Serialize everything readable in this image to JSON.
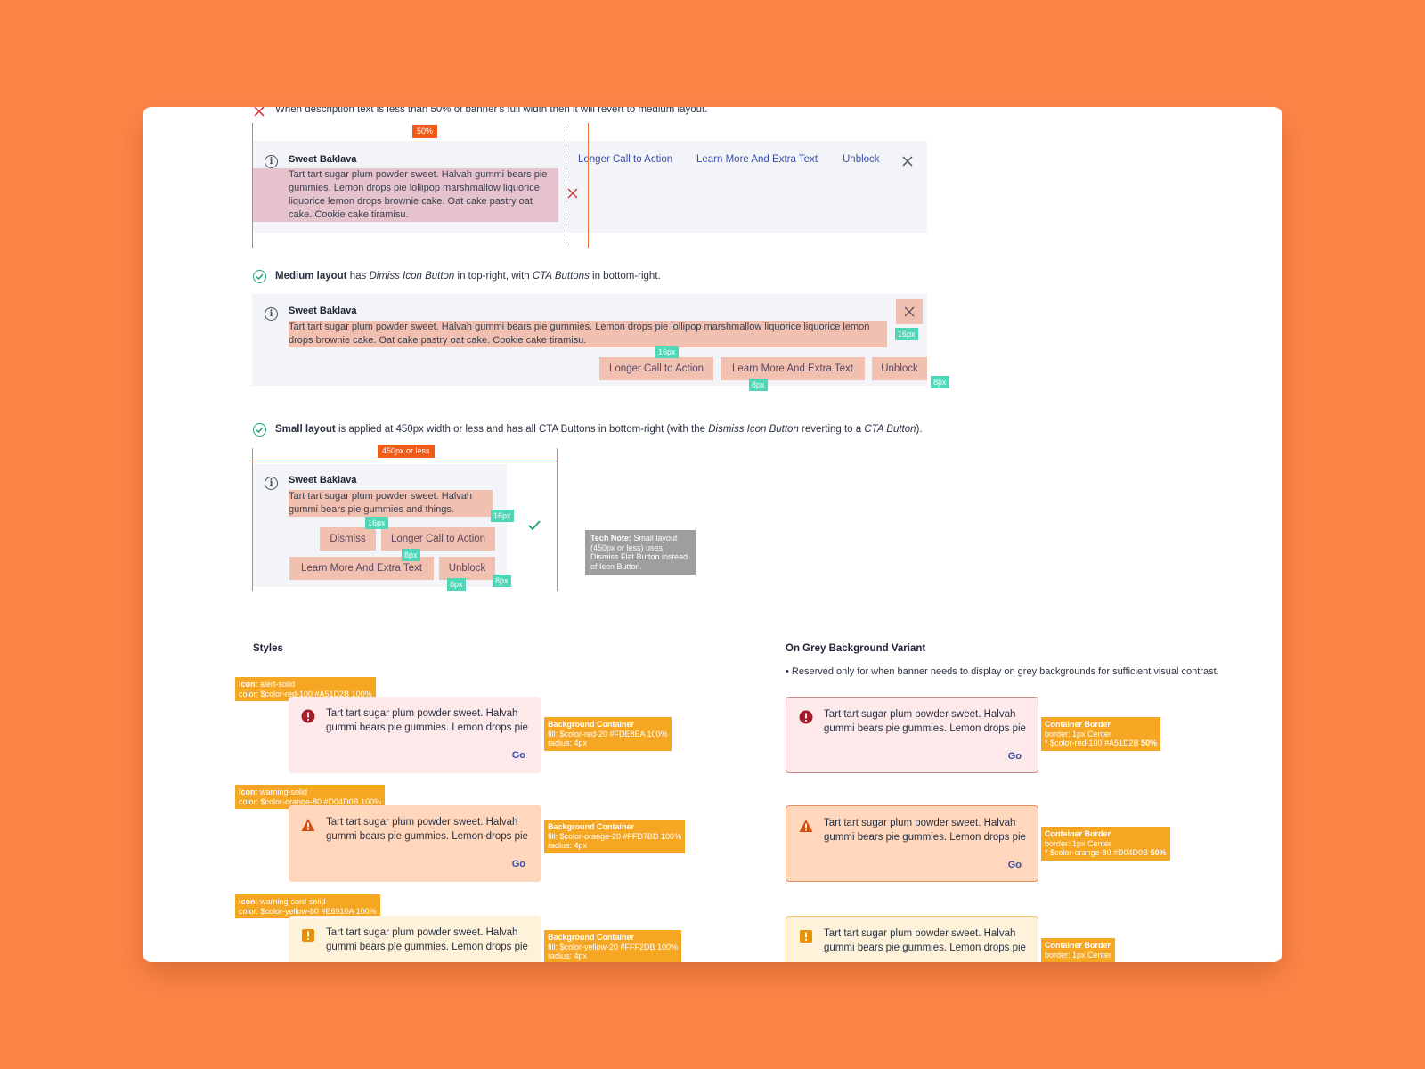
{
  "intro": {
    "warning": "When description text is less than 50% of banner's full width then it will revert to medium layout."
  },
  "large_example": {
    "badge": "50%",
    "title": "Sweet Baklava",
    "description": "Tart tart sugar plum powder sweet. Halvah gummi bears pie gummies. Lemon drops pie lollipop marshmallow liquorice liquorice lemon drops brownie cake. Oat cake pastry oat cake. Cookie cake tiramisu.",
    "actions": [
      "Longer Call to Action",
      "Learn More And Extra Text",
      "Unblock"
    ]
  },
  "medium": {
    "lead_bold": "Medium layout",
    "text1": " has ",
    "em1": "Dimiss Icon Button",
    "text2": " in top-right, with ",
    "em2": "CTA Buttons",
    "text3": " in bottom-right.",
    "title": "Sweet Baklava",
    "description": "Tart tart sugar plum powder sweet. Halvah gummi bears pie gummies. Lemon drops pie lollipop marshmallow liquorice liquorice lemon drops brownie cake. Oat cake pastry oat cake. Cookie cake tiramisu.",
    "actions": [
      "Longer Call to Action",
      "Learn More And Extra Text",
      "Unblock"
    ],
    "spacing": [
      "16px",
      "16px",
      "8px",
      "8px"
    ]
  },
  "small": {
    "lead_bold": "Small layout",
    "text1": " is applied at 450px width or less and has all CTA Buttons in bottom-right (with the ",
    "em1": "Dismiss Icon Button",
    "text2": " reverting to a ",
    "em2": "CTA Button",
    "text3": ").",
    "badge": "450px or less",
    "title": "Sweet Baklava",
    "description": "Tart tart sugar plum powder sweet. Halvah gummi bears pie gummies and things.",
    "actions": [
      "Dismiss",
      "Longer Call to Action",
      "Learn More And Extra Text",
      "Unblock"
    ],
    "spacing": [
      "16px",
      "16px",
      "8px",
      "8px",
      "8px"
    ],
    "tech_note_bold": "Tech Note:",
    "tech_note": " Small layout (450px or less) uses Dismiss Flat Button instead of Icon Button."
  },
  "styles": {
    "heading": "Styles",
    "sample_text": "Tart tart sugar plum powder sweet. Halvah gummi bears pie gummies. Lemon drops pie",
    "go": "Go",
    "items": [
      {
        "icon_label": "icon:",
        "icon_name": "alert-solid",
        "icon_color": "color: $color-red-100 #A51D2B 100%",
        "bg_title": "Background Container",
        "bg_fill": "fill: $color-red-20 #FDE8EA 100%",
        "bg_radius": "radius: 4px",
        "accent": "#a51d2b",
        "fill": "#fde8ea"
      },
      {
        "icon_label": "icon:",
        "icon_name": "warning-solid",
        "icon_color": "color: $color-orange-80 #D04D0B 100%",
        "bg_title": "Background Container",
        "bg_fill": "fill: $color-orange-20 #FFD7BD 100%",
        "bg_radius": "radius: 4px",
        "accent": "#d04d0b",
        "fill": "#ffd7bd"
      },
      {
        "icon_label": "icon:",
        "icon_name": "warning-card-solid",
        "icon_color": "color: $color-yellow-80 #E6910A 100%",
        "bg_title": "Background Container",
        "bg_fill": "fill: $color-yellow-20 #FFF2DB 100%",
        "bg_radius": "radius: 4px",
        "accent": "#e6910a",
        "fill": "#fff2db"
      }
    ]
  },
  "grey_variant": {
    "heading": "On Grey Background Variant",
    "note": "• Reserved only for when banner needs to display on grey backgrounds for sufficient visual contrast.",
    "items": [
      {
        "title": "Container Border",
        "border": "border: 1px Center",
        "color": " * $color-red-100 #A51D2B ",
        "pct": "50%"
      },
      {
        "title": "Container Border",
        "border": "border: 1px Center",
        "color": " * $color-orange-80 #D04D0B ",
        "pct": "50%"
      },
      {
        "title": "Container Border",
        "border": "border: 1px Center",
        "color": "",
        "pct": ""
      }
    ]
  }
}
